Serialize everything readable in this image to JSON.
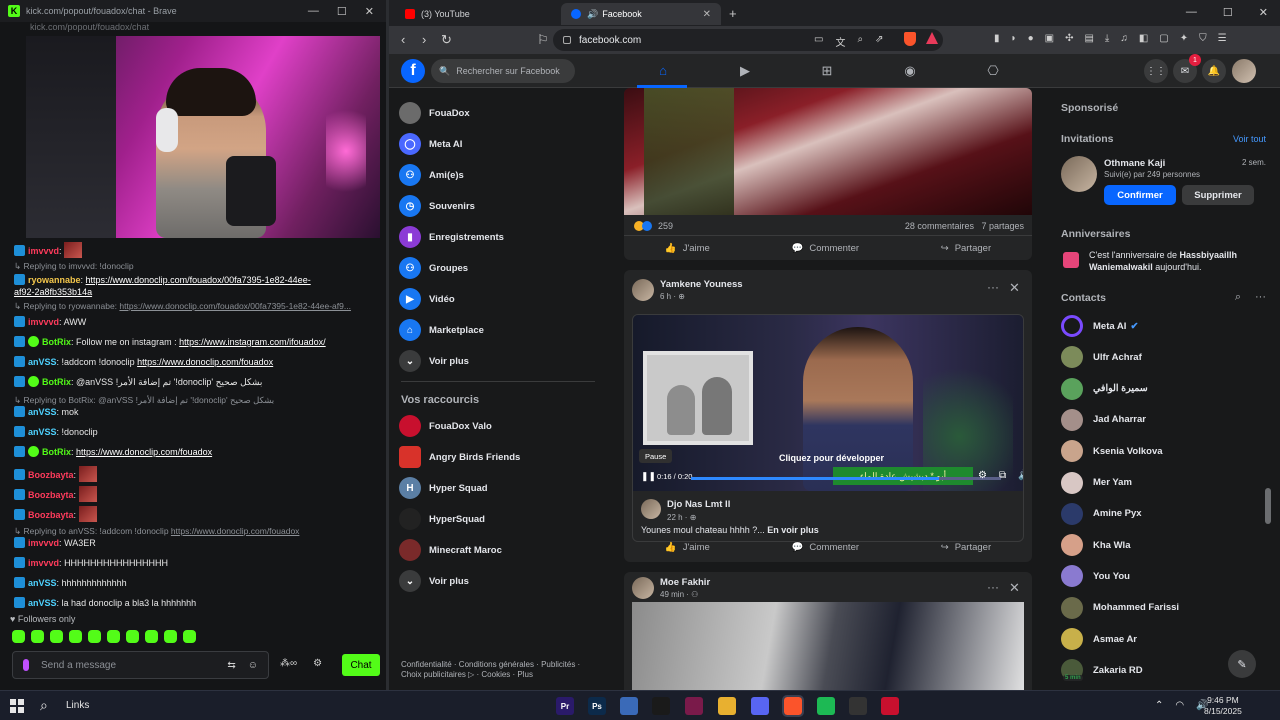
{
  "kick": {
    "title": "kick.com/popout/fouadox/chat - Brave",
    "url_text": "kick.com/popout/fouadox/chat",
    "logo": "K",
    "followers_only": "Followers only",
    "send_placeholder": "Send a message",
    "chat_button": "Chat",
    "messages": [
      {
        "type": "msg",
        "user": "imvvvd",
        "user_color": "red",
        "sep": ":",
        "text": "",
        "emote": true
      },
      {
        "type": "reply",
        "text": "Replying to imvvvd: !donoclip"
      },
      {
        "type": "msg",
        "user": "ryowannabe",
        "user_color": "yellow",
        "sep": ":",
        "link": "https://www.donoclip.com/fouadox/00fa7395-1e82-44ee-",
        "link2": "af92-2a8fb353b14a"
      },
      {
        "type": "reply",
        "text": "Replying to ryowannabe:",
        "link": "https://www.donoclip.com/fouadox/00fa7395-1e82-44ee-af9..."
      },
      {
        "type": "msg",
        "user": "imvvvd",
        "user_color": "red",
        "sep": ":",
        "text": "AWW"
      },
      {
        "type": "msg",
        "user": "BotRix",
        "user_color": "green",
        "bot": true,
        "sep": ":",
        "text": "Follow me on instagram :",
        "link": "https://www.instagram.com/ifouadox/"
      },
      {
        "type": "msg",
        "user": "anVSS",
        "user_color": "cyan",
        "sep": ":",
        "text": "!addcom !donoclip",
        "link": "https://www.donoclip.com/fouadox"
      },
      {
        "type": "msg",
        "user": "BotRix",
        "user_color": "green",
        "bot": true,
        "sep": ":",
        "text": "@anVSS !تم إضافة الأمر '!donoclip' بشكل صحيح"
      },
      {
        "type": "reply",
        "text": "Replying to BotRix: @anVSS !تم إضافة الأمر '!donoclip' بشكل صحيح"
      },
      {
        "type": "msg",
        "user": "anVSS",
        "user_color": "cyan",
        "sep": ":",
        "text": "mok"
      },
      {
        "type": "msg",
        "user": "anVSS",
        "user_color": "cyan",
        "sep": ":",
        "text": "!donoclip"
      },
      {
        "type": "msg",
        "user": "BotRix",
        "user_color": "green",
        "bot": true,
        "sep": ":",
        "link": "https://www.donoclip.com/fouadox"
      },
      {
        "type": "msg",
        "user": "Boozbayta",
        "user_color": "red",
        "sep": ":",
        "text": "",
        "emote": true
      },
      {
        "type": "msg",
        "user": "Boozbayta",
        "user_color": "red",
        "sep": ":",
        "text": "",
        "emote": true
      },
      {
        "type": "msg",
        "user": "Boozbayta",
        "user_color": "red",
        "sep": ":",
        "text": "",
        "emote": true
      },
      {
        "type": "reply",
        "text": "Replying to anVSS: !addcom !donoclip",
        "link": "https://www.donoclip.com/fouadox"
      },
      {
        "type": "msg",
        "user": "imvvvd",
        "user_color": "red",
        "sep": ":",
        "text": "WA3ER"
      },
      {
        "type": "msg",
        "user": "imvvvd",
        "user_color": "red",
        "sep": ":",
        "text": "HHHHHHHHHHHHHHHH"
      },
      {
        "type": "msg",
        "user": "anVSS",
        "user_color": "cyan",
        "sep": ":",
        "text": "hhhhhhhhhhhhh"
      },
      {
        "type": "msg",
        "user": "anVSS",
        "user_color": "cyan",
        "sep": ":",
        "text": "la had donoclip a bla3 la hhhhhhh"
      }
    ]
  },
  "browser": {
    "tabs": [
      {
        "label": "(3) YouTube",
        "color": "#ff0000"
      },
      {
        "label": "Facebook",
        "color": "#0866ff"
      }
    ],
    "new_tab": "+",
    "url": "facebook.com"
  },
  "facebook": {
    "logo": "f",
    "search_placeholder": "Rechercher sur Facebook",
    "notif_count": "1",
    "left_nav": [
      {
        "label": "FouaDox",
        "color": "#6b6b6b"
      },
      {
        "label": "Meta AI",
        "color": "#4a68ff"
      },
      {
        "label": "Ami(e)s",
        "color": "#1877f2"
      },
      {
        "label": "Souvenirs",
        "color": "#1877f2"
      },
      {
        "label": "Enregistrements",
        "color": "#8b3bd6"
      },
      {
        "label": "Groupes",
        "color": "#1877f2"
      },
      {
        "label": "Vidéo",
        "color": "#1877f2"
      },
      {
        "label": "Marketplace",
        "color": "#1877f2"
      },
      {
        "label": "Voir plus",
        "color": "#3a3b3c"
      }
    ],
    "shortcuts_title": "Vos raccourcis",
    "shortcuts": [
      {
        "label": "FouaDox Valo",
        "color": "#c8102e"
      },
      {
        "label": "Angry Birds Friends",
        "color": "#d8322a"
      },
      {
        "label": "Hyper Squad",
        "color": "#5b7fa5"
      },
      {
        "label": "HyperSquad",
        "color": "#222"
      },
      {
        "label": "Minecraft Maroc",
        "color": "#7a2a2a"
      },
      {
        "label": "Voir plus",
        "color": "#3a3b3c"
      }
    ],
    "footer": "Confidentialité · Conditions générales · Publicités · Choix publicitaires ▷ · Cookies · Plus",
    "post1": {
      "reaction_count": "259",
      "comments": "28 commentaires",
      "shares": "7 partages"
    },
    "actions": {
      "like": "J'aime",
      "comment": "Commenter",
      "share": "Partager"
    },
    "post2": {
      "author": "Yamkene Youness",
      "time": "6 h · ",
      "video_time": "0:16 / 0:20",
      "video_progress": 0.8,
      "pause_tip": "Pause",
      "expand_tip": "Cliquez pour développer",
      "caption": "أبو * دبشيش عادة الماء",
      "shared_author": "Djo Nas Lmt Il",
      "shared_time": "22 h · ",
      "shared_text": "Younes moul chateau hhhh ?...",
      "shared_more": "En voir plus"
    },
    "post3": {
      "author": "Moe Fakhir",
      "time": "49 min · "
    },
    "right": {
      "sponsored": "Sponsorisé",
      "invitations": "Invitations",
      "see_all": "Voir tout",
      "invite_name": "Othmane Kaji",
      "invite_time": "2 sem.",
      "invite_sub": "Suivi(e) par 249 personnes",
      "confirm": "Confirmer",
      "delete": "Supprimer",
      "birthdays": "Anniversaires",
      "bday_prefix": "C'est l'anniversaire de ",
      "bday_name": "Hassbiyaaillh Waniemalwakil",
      "bday_suffix": " aujourd'hui.",
      "contacts_title": "Contacts",
      "contacts": [
        {
          "name": "Meta AI",
          "color": "#4a68ff"
        },
        {
          "name": "Ulfr Achraf",
          "color": "#7c8b5a"
        },
        {
          "name": "سميرة الوافي",
          "color": "#5aa25c"
        },
        {
          "name": "Jad Aharrar",
          "color": "#a48f8a"
        },
        {
          "name": "Ksenia Volkova",
          "color": "#c9a48c"
        },
        {
          "name": "Mer Yam",
          "color": "#d8c7c4"
        },
        {
          "name": "Amine Pyx",
          "color": "#2b3a6a"
        },
        {
          "name": "Kha Wla",
          "color": "#d6a089"
        },
        {
          "name": "You You",
          "color": "#8a7ad0"
        },
        {
          "name": "Mohammed Farissi",
          "color": "#6a6a4a"
        },
        {
          "name": "Asmae Ar",
          "color": "#c8b04a"
        },
        {
          "name": "Zakaria RD",
          "color": "#4a5a3a"
        }
      ],
      "zakaria_badge": "5 min"
    }
  },
  "taskbar": {
    "links": "Links",
    "apps": [
      {
        "label": "Pr",
        "color": "#2a1a6a"
      },
      {
        "label": "Ps",
        "color": "#0c2a4a"
      },
      {
        "label": "",
        "color": "#3a6ab8"
      },
      {
        "label": "",
        "color": "#1a1a1a"
      },
      {
        "label": "",
        "color": "#7a1a4a"
      },
      {
        "label": "",
        "color": "#e8b030"
      },
      {
        "label": "",
        "color": "#5865f2"
      },
      {
        "label": "",
        "color": "#fb542b"
      },
      {
        "label": "",
        "color": "#1db954"
      },
      {
        "label": "",
        "color": "#333"
      },
      {
        "label": "",
        "color": "#c8102e"
      }
    ],
    "time": "9:46 PM",
    "date": "8/15/2025"
  }
}
